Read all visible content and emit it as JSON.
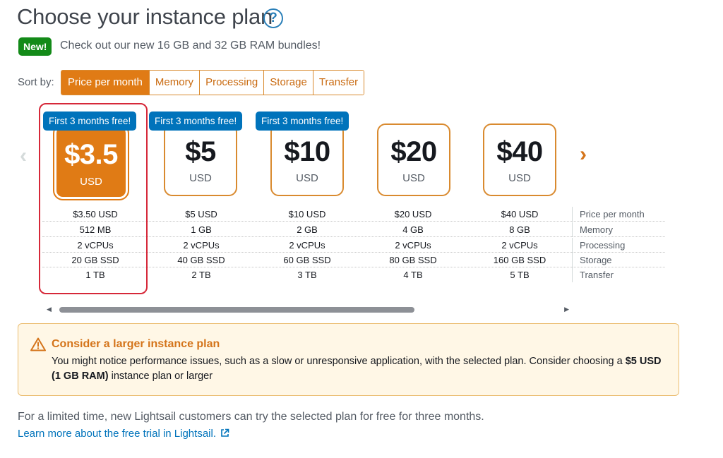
{
  "header": {
    "title": "Choose your instance plan",
    "help_icon_glyph": "?"
  },
  "announcement": {
    "badge": "New!",
    "text": "Check out our new 16 GB and 32 GB RAM bundles!"
  },
  "sort": {
    "label": "Sort by:",
    "options": [
      "Price per month",
      "Memory",
      "Processing",
      "Storage",
      "Transfer"
    ],
    "active": "Price per month"
  },
  "plans": [
    {
      "price": "$3.5",
      "currency": "USD",
      "promo": "First 3 months free!",
      "selected": true,
      "specs": [
        "$3.50 USD",
        "512 MB",
        "2 vCPUs",
        "20 GB SSD",
        "1 TB"
      ]
    },
    {
      "price": "$5",
      "currency": "USD",
      "promo": "First 3 months free!",
      "selected": false,
      "specs": [
        "$5 USD",
        "1 GB",
        "2 vCPUs",
        "40 GB SSD",
        "2 TB"
      ]
    },
    {
      "price": "$10",
      "currency": "USD",
      "promo": "First 3 months free!",
      "selected": false,
      "specs": [
        "$10 USD",
        "2 GB",
        "2 vCPUs",
        "60 GB SSD",
        "3 TB"
      ]
    },
    {
      "price": "$20",
      "currency": "USD",
      "promo": "",
      "selected": false,
      "specs": [
        "$20 USD",
        "4 GB",
        "2 vCPUs",
        "80 GB SSD",
        "4 TB"
      ]
    },
    {
      "price": "$40",
      "currency": "USD",
      "promo": "",
      "selected": false,
      "specs": [
        "$40 USD",
        "8 GB",
        "2 vCPUs",
        "160 GB SSD",
        "5 TB"
      ]
    }
  ],
  "spec_labels": [
    "Price per month",
    "Memory",
    "Processing",
    "Storage",
    "Transfer"
  ],
  "warning": {
    "title": "Consider a larger instance plan",
    "body_start": "You might notice performance issues, such as a slow or unresponsive application, with the selected plan. Consider choosing a ",
    "body_bold": "$5 USD (1 GB RAM)",
    "body_end": " instance plan or larger"
  },
  "footer": {
    "text": "For a limited time, new Lightsail customers can try the selected plan for free for three months.",
    "link": "Learn more about the free trial in Lightsail."
  },
  "icons": {
    "prev": "chevron-left-icon",
    "next": "chevron-right-icon",
    "warning": "warning-triangle-icon",
    "external": "external-link-icon",
    "help": "help-circle-icon"
  },
  "colors": {
    "accent": "#e07b15",
    "promo": "#0073bb",
    "new_badge": "#138a18",
    "selection_outline": "#d62839",
    "warning_bg": "#fff7e6"
  }
}
